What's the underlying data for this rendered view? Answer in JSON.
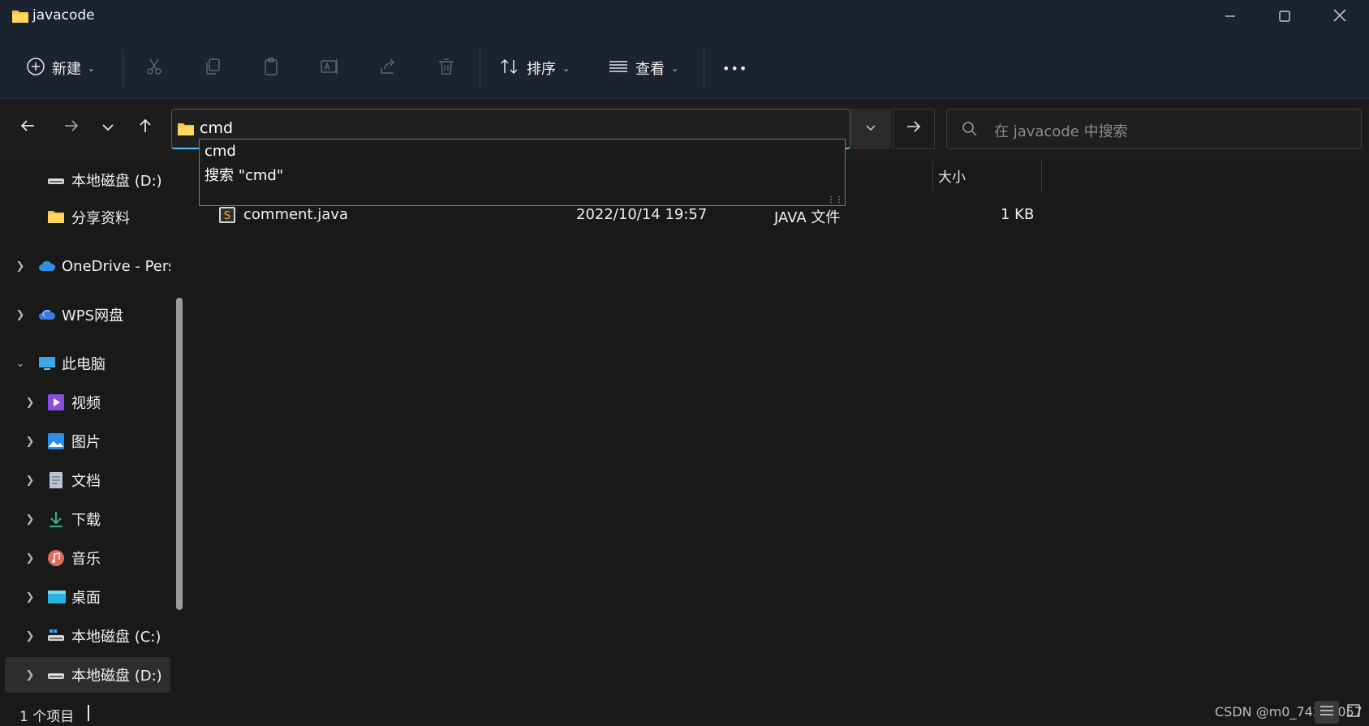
{
  "window": {
    "title": "javacode",
    "icons": {
      "folder": "folder-icon",
      "minimize": "minimize-icon",
      "maximize": "maximize-icon",
      "close": "close-icon"
    }
  },
  "toolbar": {
    "new_label": "新建",
    "sort_label": "排序",
    "view_label": "查看",
    "more_label": "•••"
  },
  "address": {
    "value": "cmd",
    "suggestions": [
      "cmd",
      "搜索 \"cmd\""
    ]
  },
  "search": {
    "placeholder": "在 javacode 中搜索"
  },
  "sidebar": {
    "items": [
      {
        "label": "本地磁盘 (D:)",
        "icon": "drive-icon"
      },
      {
        "label": "分享资料",
        "icon": "folder-icon"
      },
      {
        "label": "OneDrive - Pers",
        "icon": "cloud-icon"
      },
      {
        "label": "WPS网盘",
        "icon": "cloud-icon"
      },
      {
        "label": "此电脑",
        "icon": "computer-icon"
      },
      {
        "label": "视频",
        "icon": "video-icon"
      },
      {
        "label": "图片",
        "icon": "picture-icon"
      },
      {
        "label": "文档",
        "icon": "document-icon"
      },
      {
        "label": "下载",
        "icon": "download-icon"
      },
      {
        "label": "音乐",
        "icon": "music-icon"
      },
      {
        "label": "桌面",
        "icon": "desktop-icon"
      },
      {
        "label": "本地磁盘 (C:)",
        "icon": "drive-icon"
      },
      {
        "label": "本地磁盘 (D:)",
        "icon": "drive-icon"
      }
    ]
  },
  "filelist": {
    "size_header": "大小",
    "rows": [
      {
        "name": "comment.java",
        "modified": "2022/10/14 19:57",
        "type": "JAVA 文件",
        "size": "1 KB"
      }
    ]
  },
  "status": {
    "count": "1 个项目"
  },
  "watermark": "CSDN @m0_74229057",
  "colors": {
    "accent": "#4cc2ff",
    "folder": "#f5c443",
    "background": "#191919",
    "toolbar": "#1b2230"
  }
}
